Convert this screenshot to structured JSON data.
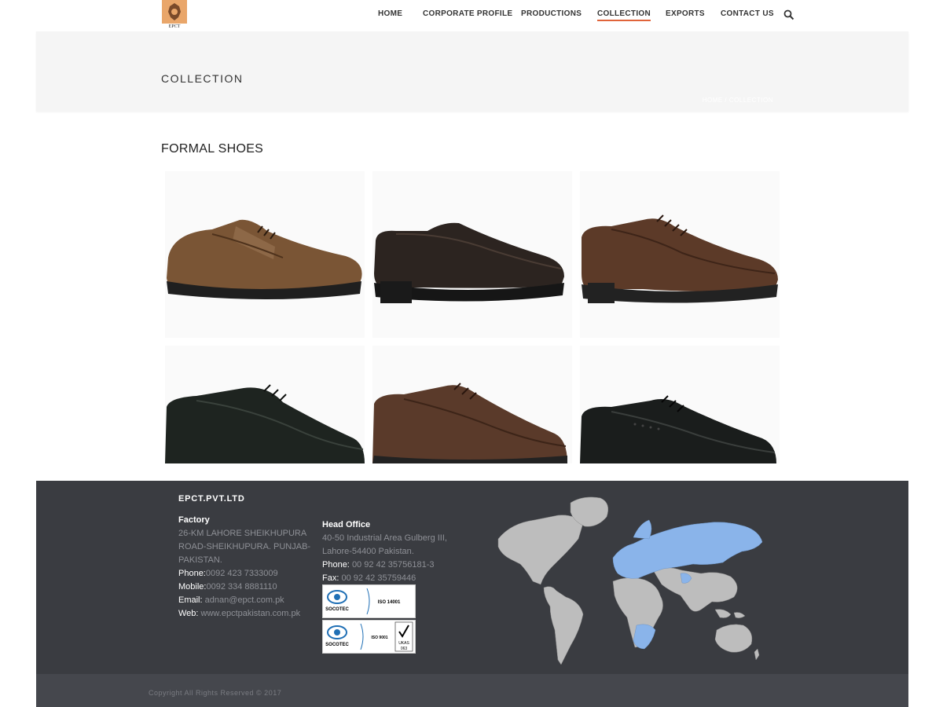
{
  "header": {
    "logo_text": "EPCT",
    "nav": [
      {
        "label": "HOME"
      },
      {
        "label": "CORPORATE PROFILE"
      },
      {
        "label": "PRODUCTIONS"
      },
      {
        "label": "COLLECTION",
        "active": true
      },
      {
        "label": "EXPORTS"
      },
      {
        "label": "CONTACT US"
      }
    ],
    "search_icon": "search-icon",
    "accent_color": "#e0643a"
  },
  "page_title": "COLLECTION",
  "breadcrumb": {
    "home": "HOME",
    "separator": " / ",
    "current": "COLLECTION"
  },
  "section_title": "FORMAL SHOES",
  "gallery": {
    "items": [
      {
        "description": "brown leather casual shoe with strap"
      },
      {
        "description": "dark brown slip-on loafer"
      },
      {
        "description": "brown lace-up derby shoe"
      },
      {
        "description": "black lace-up shoe"
      },
      {
        "description": "brown lace-up oxford shoe"
      },
      {
        "description": "black brogue lace-up shoe"
      }
    ]
  },
  "footer": {
    "brand": "EPCT.PVT.LTD",
    "factory": {
      "heading": "Factory",
      "address_lines": [
        "26-KM LAHORE SHEIKHUPURA",
        "ROAD-SHEIKHUPURA. PUNJAB-",
        "PAKISTAN."
      ],
      "phone_label": "Phone:",
      "phone": "0092 423 7333009",
      "mobile_label": "Mobile:",
      "mobile": "0092 334 8881110",
      "email_label": "Email:",
      "email": "adnan@epct.com.pk",
      "web_label": "Web:",
      "web": "www.epctpakistan.com.pk"
    },
    "head_office": {
      "heading": "Head Office",
      "address_lines": [
        "40-50 Industrial Area Gulberg III,",
        "Lahore-54400 Pakistan."
      ],
      "phone_label": "Phone:",
      "phone": "00 92 42 35756181-3",
      "fax_label": "Fax:",
      "fax": "00 92 42 35759446"
    },
    "certificates": [
      {
        "org": "SOCOTEC",
        "standard": "ISO 14001"
      },
      {
        "org": "SOCOTEC",
        "standard": "ISO 9001",
        "badge": "UKAS",
        "badge_number": "063"
      }
    ],
    "copyright": "Copyright All Rights Reserved © 2017",
    "colors": {
      "footer_bg": "#3a3c41",
      "map_land": "#bdbdbd",
      "map_highlight": "#8ab4ea"
    }
  }
}
